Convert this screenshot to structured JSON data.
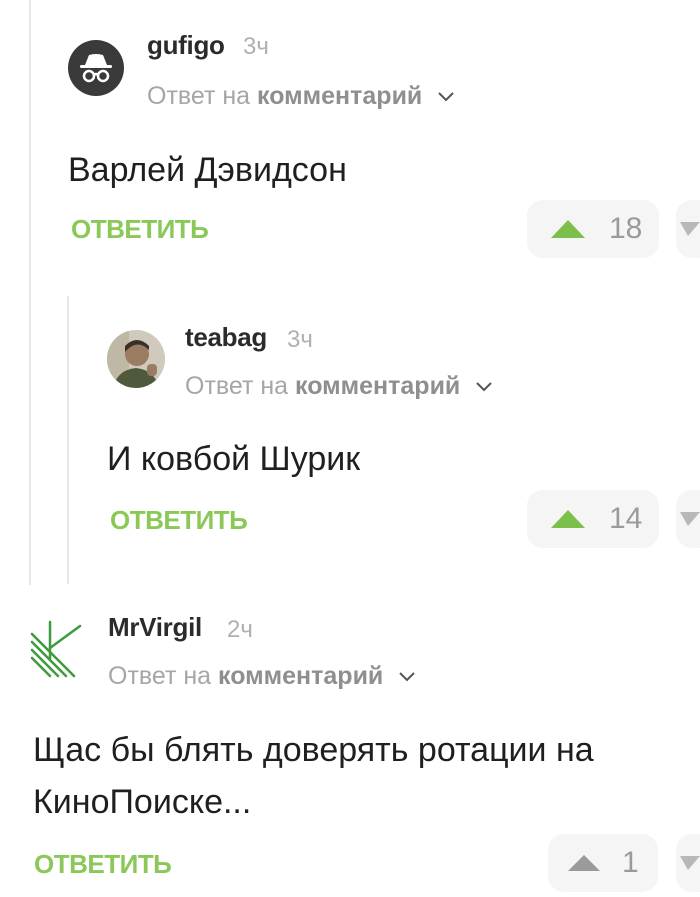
{
  "comments": [
    {
      "author": "gufigo",
      "time": "3ч",
      "reply_prefix": "Ответ на",
      "reply_target": "комментарий",
      "text": "Варлей Дэвидсон",
      "reply_label": "ОТВЕТИТЬ",
      "rating": "18",
      "avatar_icon": "incognito-icon"
    },
    {
      "author": "teabag",
      "time": "3ч",
      "reply_prefix": "Ответ на",
      "reply_target": "комментарий",
      "text": "И ковбой Шурик",
      "reply_label": "ОТВЕТИТЬ",
      "rating": "14",
      "avatar_icon": "user-photo"
    },
    {
      "author": "MrVirgil",
      "time": "2ч",
      "reply_prefix": "Ответ на",
      "reply_target": "комментарий",
      "text": "Щас бы блять доверять ротации на КиноПоиске...",
      "reply_label": "ОТВЕТИТЬ",
      "rating": "1",
      "avatar_icon": "green-stripes-logo"
    }
  ],
  "colors": {
    "accent_green": "#8ac858",
    "upvote_green": "#7cc04b",
    "muted_text": "#a6a6a6"
  }
}
